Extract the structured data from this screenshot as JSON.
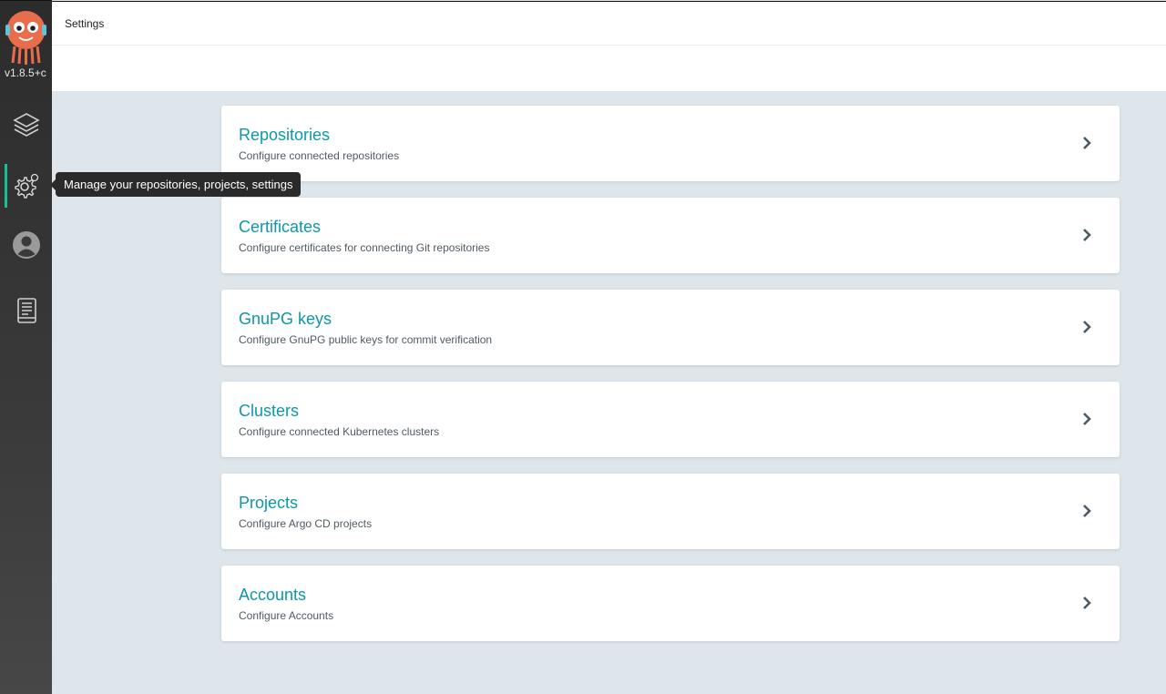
{
  "app": {
    "version": "v1.8.5+c",
    "accent_color": "#18be94",
    "link_color": "#0d98a8"
  },
  "header": {
    "title": "Settings"
  },
  "sidebar": {
    "items": [
      {
        "icon": "layers-icon",
        "name": "applications"
      },
      {
        "icon": "gear-icon",
        "name": "settings",
        "active": true
      },
      {
        "icon": "user-icon",
        "name": "user-info"
      },
      {
        "icon": "docs-icon",
        "name": "documentation"
      }
    ]
  },
  "tooltip": {
    "text": "Manage your repositories, projects, settings"
  },
  "settings": [
    {
      "title": "Repositories",
      "description": "Configure connected repositories"
    },
    {
      "title": "Certificates",
      "description": "Configure certificates for connecting Git repositories"
    },
    {
      "title": "GnuPG keys",
      "description": "Configure GnuPG public keys for commit verification"
    },
    {
      "title": "Clusters",
      "description": "Configure connected Kubernetes clusters"
    },
    {
      "title": "Projects",
      "description": "Configure Argo CD projects"
    },
    {
      "title": "Accounts",
      "description": "Configure Accounts"
    }
  ]
}
